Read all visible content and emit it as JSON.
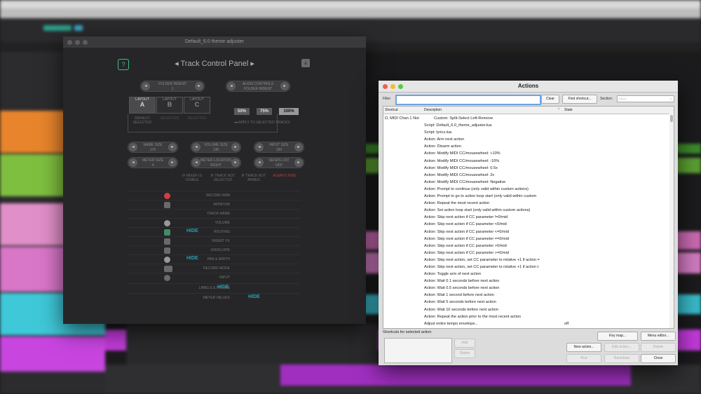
{
  "theme_window": {
    "title": "Default_6.0 theme adjuster",
    "panel_title": "Track Control Panel",
    "prev_arrow": "◂",
    "next_arrow": "▸",
    "folder_indent_label": "FOLDER INDENT",
    "folder_indent_value": "1",
    "align_controls_label": "ALIGN CONTROLS",
    "align_controls_value": "FOLDER INDENT",
    "layouts": [
      {
        "word": "LAYOUT",
        "letter": "A",
        "sub": "DEFAULT SELECTED"
      },
      {
        "word": "LAYOUT",
        "letter": "B",
        "sub": "SELECTED"
      },
      {
        "word": "LAYOUT",
        "letter": "C",
        "sub": "SELECTED"
      }
    ],
    "scales": [
      "50%",
      "75%",
      "100%"
    ],
    "apply_label": "◂◂  APPLY TO SELECTED TRACKS",
    "controls": [
      {
        "label": "NAME SIZE",
        "value": "170"
      },
      {
        "label": "VOLUME SIZE",
        "value": "130"
      },
      {
        "label": "INPUT SIZE",
        "value": "150"
      },
      {
        "label": "METER SIZE",
        "value": "4"
      },
      {
        "label": "METER LOCATION",
        "value": "RIGHT"
      },
      {
        "label": "SENDS LIST",
        "value": "OFF"
      }
    ],
    "visibility_headers": [
      "IF MIXER IS VISIBLE",
      "IF TRACK NOT SELECTED",
      "IF TRACK NOT ARMED",
      "ALWAYS HIDE"
    ],
    "rows": [
      "RECORD ARM",
      "MONITOR",
      "TRACK NAME",
      "VOLUME",
      "ROUTING",
      "INSERT FX",
      "ENVELOPE",
      "PAN & WIDTH",
      "RECORD MODE",
      "INPUT",
      "LABELS & VALUES",
      "METER VALUES"
    ],
    "hide_text": "HIDE"
  },
  "actions_window": {
    "title": "Actions",
    "filter_label": "Filter",
    "filter_value": "",
    "clear_button": "Clear",
    "find_shortcut_button": "Find shortcut...",
    "section_label": "Section:",
    "section_value": "Main",
    "columns": {
      "shortcut": "Shortcut",
      "description": "Description",
      "state": "State"
    },
    "rows": [
      {
        "shortcut": "D, MIDI Chan 1 Not",
        "description": "Custom: Split-Select Left-Remove",
        "state": ""
      },
      {
        "shortcut": "",
        "description": "Script: Default_6.0_theme_adjuster.lua",
        "state": ""
      },
      {
        "shortcut": "",
        "description": "Script: lyrics.lua",
        "state": ""
      },
      {
        "shortcut": "",
        "description": "Action: Arm next action",
        "state": ""
      },
      {
        "shortcut": "",
        "description": "Action: Disarm action",
        "state": ""
      },
      {
        "shortcut": "",
        "description": "Action: Modify MIDI CC/mousewheel: +10%",
        "state": ""
      },
      {
        "shortcut": "",
        "description": "Action: Modify MIDI CC/mousewheel: -10%",
        "state": ""
      },
      {
        "shortcut": "",
        "description": "Action: Modify MIDI CC/mousewheel: 0.5x",
        "state": ""
      },
      {
        "shortcut": "",
        "description": "Action: Modify MIDI CC/mousewheel: 2x",
        "state": ""
      },
      {
        "shortcut": "",
        "description": "Action: Modify MIDI CC/mousewheel: Negative",
        "state": ""
      },
      {
        "shortcut": "",
        "description": "Action: Prompt to continue (only valid within custom actions)",
        "state": ""
      },
      {
        "shortcut": "",
        "description": "Action: Prompt to go to action loop start (only valid within custom",
        "state": ""
      },
      {
        "shortcut": "",
        "description": "Action: Repeat the most recent action",
        "state": ""
      },
      {
        "shortcut": "",
        "description": "Action: Set action loop start (only valid within custom actions)",
        "state": ""
      },
      {
        "shortcut": "",
        "description": "Action: Skip next action if CC parameter !=0/mid",
        "state": ""
      },
      {
        "shortcut": "",
        "description": "Action: Skip next action if CC parameter <0/mid",
        "state": ""
      },
      {
        "shortcut": "",
        "description": "Action: Skip next action if CC parameter <=0/mid",
        "state": ""
      },
      {
        "shortcut": "",
        "description": "Action: Skip next action if CC parameter ==0/mid",
        "state": ""
      },
      {
        "shortcut": "",
        "description": "Action: Skip next action if CC parameter >0/mid",
        "state": ""
      },
      {
        "shortcut": "",
        "description": "Action: Skip next action if CC parameter >=0/mid",
        "state": ""
      },
      {
        "shortcut": "",
        "description": "Action: Skip next action, set CC parameter to relative +1 if action =",
        "state": ""
      },
      {
        "shortcut": "",
        "description": "Action: Skip next action, set CC parameter to relative +1 if action t",
        "state": ""
      },
      {
        "shortcut": "",
        "description": "Action: Toggle arm of next action",
        "state": ""
      },
      {
        "shortcut": "",
        "description": "Action: Wait 0.1 seconds before next action",
        "state": ""
      },
      {
        "shortcut": "",
        "description": "Action: Wait 0.5 seconds before next action",
        "state": ""
      },
      {
        "shortcut": "",
        "description": "Action: Wait 1 second before next action",
        "state": ""
      },
      {
        "shortcut": "",
        "description": "Action: Wait 5 seconds before next action",
        "state": ""
      },
      {
        "shortcut": "",
        "description": "Action: Wait 10 seconds before next action",
        "state": ""
      },
      {
        "shortcut": "",
        "description": "Action: Repeat the action prior to the most recent action",
        "state": ""
      },
      {
        "shortcut": "",
        "description": "Adjust entire tempo envelope...",
        "state": "off"
      }
    ],
    "shortcuts_label": "Shortcuts for selected action",
    "add_button": "Add",
    "delete_shortcut_button": "Delete",
    "key_map_button": "Key map...",
    "menu_editor_button": "Menu editor...",
    "new_action_button": "New action...",
    "edit_action_button": "Edit action...",
    "delete_button": "Delete",
    "run_button": "Run",
    "run_close_button": "Run/close",
    "close_button": "Close"
  },
  "colors": {
    "accent_hide": "#28a0b8",
    "help_green": "#3fbf7f",
    "filter_focus": "#6aa4e8"
  }
}
